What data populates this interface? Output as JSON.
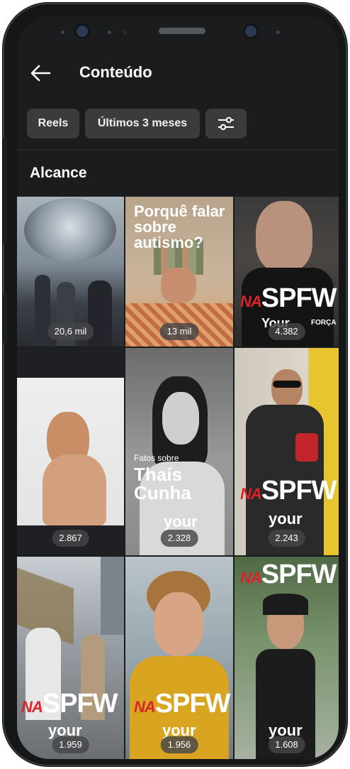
{
  "header": {
    "title": "Conteúdo",
    "back_icon": "arrow-left-icon"
  },
  "filters": {
    "chips": [
      "Reels",
      "Últimos 3 meses"
    ],
    "filter_icon": "sliders-icon"
  },
  "section": {
    "title": "Alcance"
  },
  "reels": [
    {
      "reach": "20,6 mil"
    },
    {
      "reach": "13 mil",
      "overlay": "Porquê falar sobre autismo?"
    },
    {
      "reach": "4.382",
      "overlay_na": "NA",
      "overlay": "SPFW",
      "overlay_hour": "Your",
      "overlay_extra": "FORÇA"
    },
    {
      "reach": "2.867"
    },
    {
      "reach": "2.328",
      "overlay_small": "Fatos sobre",
      "overlay": "Thaís Cunha",
      "overlay_hour": "your"
    },
    {
      "reach": "2.243",
      "overlay_na": "NA",
      "overlay": "SPFW",
      "overlay_hour": "your"
    },
    {
      "reach": "1.959",
      "overlay_na": "NA",
      "overlay": "SPFW",
      "overlay_hour": "your"
    },
    {
      "reach": "1.956",
      "overlay_na": "NA",
      "overlay": "SPFW",
      "overlay_hour": "your"
    },
    {
      "reach": "1.608",
      "overlay_na": "NA",
      "overlay": "SPFW",
      "overlay_hour": "your"
    }
  ],
  "colors": {
    "background": "#1b1c1e",
    "chip": "#3a3b3d",
    "accent_red": "#d9242b"
  }
}
